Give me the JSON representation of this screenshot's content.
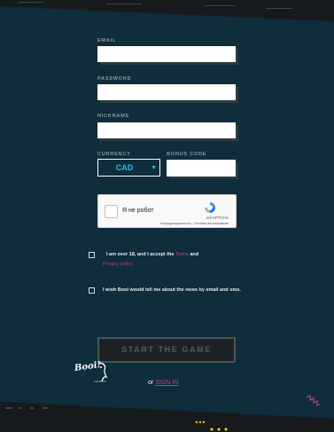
{
  "form": {
    "email_label": "EMAIL",
    "password_label": "PASSWORD",
    "nickname_label": "NICKNAME",
    "currency_label": "CURRENCY",
    "bonus_label": "BONUS CODE",
    "currency_value": "CAD"
  },
  "recaptcha": {
    "label": "Я не робот",
    "brand": "reCAPTCHA",
    "links": "Конфиденциальность - Условия использования"
  },
  "consents": {
    "age_text": "I am over 18, and I accept the",
    "terms_link": "Terms",
    "and_text": "and",
    "privacy_link": "Privacy policy",
    "news_text": "I wish Booi would tell me about the news by email and sms."
  },
  "actions": {
    "start_label": "START THE GAME",
    "or_text": "or",
    "signin_label": "SIGN IN"
  },
  "branding": {
    "mascot_text": "Booi!"
  },
  "colors": {
    "background": "#0f2d3b",
    "accent_pink": "#c93a84",
    "accent_cyan": "#21c4e8",
    "accent_yellow": "#f5c518"
  }
}
